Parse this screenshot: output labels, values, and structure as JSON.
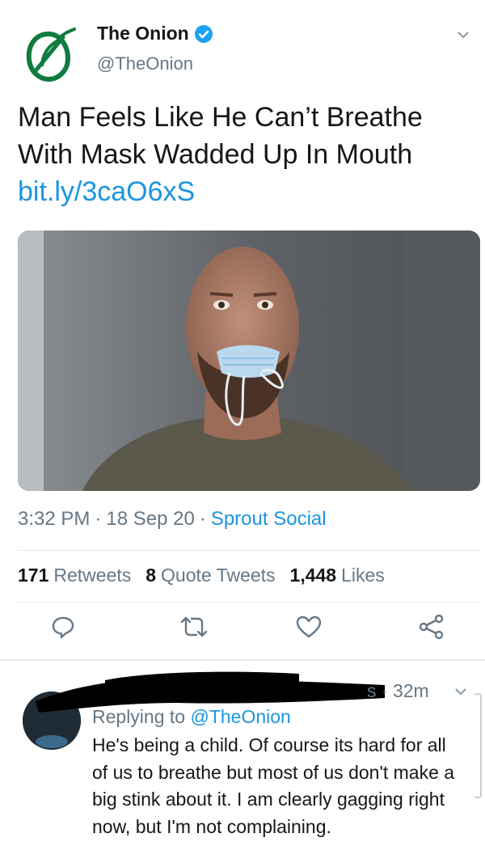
{
  "tweet": {
    "account_name": "The Onion",
    "handle": "@TheOnion",
    "text": "Man Feels Like He Can’t Breathe With Mask Wadded Up In Mouth",
    "link": "bit.ly/3caO6xS",
    "time": "3:32 PM",
    "date": "18 Sep 20",
    "source": "Sprout Social",
    "separator": "·"
  },
  "stats": {
    "retweets_count": "171",
    "retweets_label": "Retweets",
    "quote_count": "8",
    "quote_label": "Quote Tweets",
    "likes_count": "1,448",
    "likes_label": "Likes"
  },
  "reply": {
    "time": "s · 32m",
    "replying_prefix": "Replying to",
    "replying_handle": "@TheOnion",
    "text": "He's being a child. Of course its hard for all of us to breathe but most of us don't make a big stink about it. I am clearly gagging right now, but I'm not complaining."
  },
  "colors": {
    "link_blue": "#1b95e0",
    "onion_green": "#0f7b3e",
    "verified_blue": "#1da1f2",
    "secondary_text": "#657786"
  },
  "icons": [
    "onion-logo",
    "verified-badge-icon",
    "chevron-down-icon",
    "reply-icon",
    "retweet-icon",
    "like-icon",
    "share-icon"
  ]
}
